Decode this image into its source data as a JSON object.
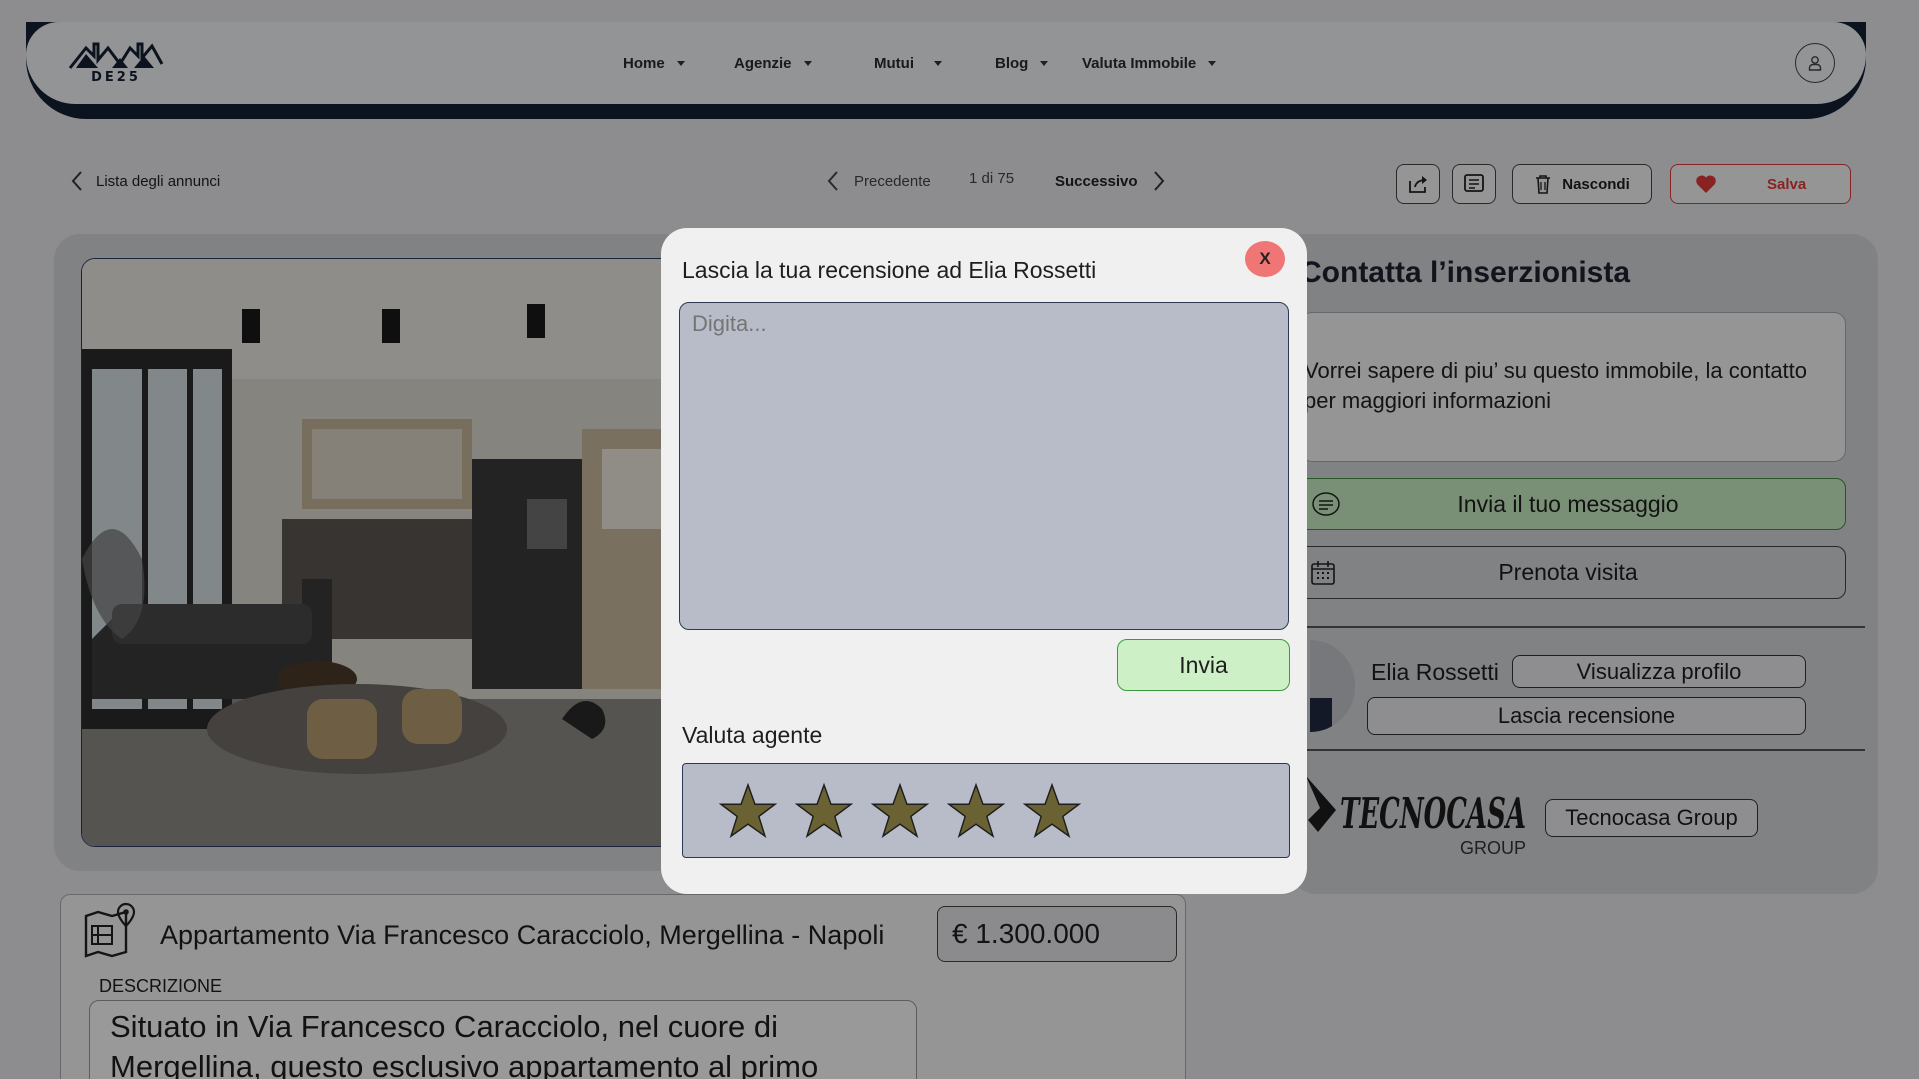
{
  "header": {
    "logo_text": "DE25",
    "nav": [
      {
        "label": "Home"
      },
      {
        "label": "Agenzie"
      },
      {
        "label": "Mutui"
      },
      {
        "label": "Blog"
      },
      {
        "label": "Valuta Immobile"
      }
    ]
  },
  "toolbar": {
    "back_label": "Lista degli annunci",
    "prev_label": "Precedente",
    "page_counter": "1 di 75",
    "next_label": "Successivo",
    "hide_label": "Nascondi",
    "save_label": "Salva"
  },
  "contact": {
    "title": "Contatta l’inserzionista",
    "message": "Vorrei sapere di piu’ su questo immobile, la contatto per maggiori informazioni",
    "send_label": "Invia il tuo messaggio",
    "visit_label": "Prenota visita",
    "agent_name": "Elia Rossetti",
    "view_profile_label": "Visualizza profilo",
    "review_label": "Lascia recensione",
    "agency_logo_text": "TECNOCASA",
    "agency_logo_sub": "GROUP",
    "agency_label": "Tecnocasa Group"
  },
  "listing": {
    "title": "Appartamento Via Francesco Caracciolo, Mergellina - Napoli",
    "price": "€ 1.300.000",
    "description_label": "DESCRIZIONE",
    "description": "Situato in Via Francesco Caracciolo, nel cuore di Mergellina, questo esclusivo appartamento al primo"
  },
  "modal": {
    "title": "Lascia la tua recensione ad Elia Rossetti",
    "close_label": "X",
    "textarea_placeholder": "Digita...",
    "submit_label": "Invia",
    "rating_label": "Valuta agente",
    "rating_max": 5,
    "star_color": "#6b6233"
  },
  "colors": {
    "navy": "#131f33",
    "green_button": "#cdf0c7",
    "red_accent": "#e03a3a",
    "close_button": "#f07575"
  }
}
